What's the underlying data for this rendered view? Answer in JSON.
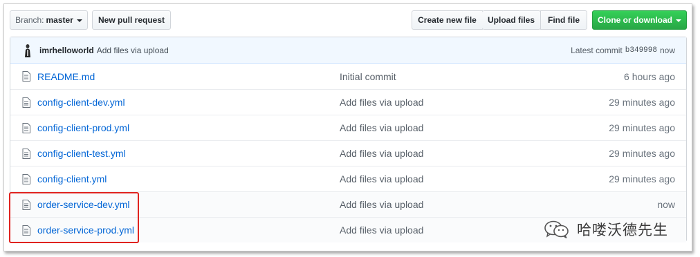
{
  "toolbar": {
    "branch_prefix": "Branch:",
    "branch_name": "master",
    "new_pull_request": "New pull request",
    "create_new_file": "Create new file",
    "upload_files": "Upload files",
    "find_file": "Find file",
    "clone_or_download": "Clone or download"
  },
  "commit_tease": {
    "author": "imrhelloworld",
    "message": "Add files via upload",
    "latest_label": "Latest commit",
    "sha": "b349998",
    "age": "now"
  },
  "files": [
    {
      "name": "README.md",
      "message": "Initial commit",
      "age": "6 hours ago"
    },
    {
      "name": "config-client-dev.yml",
      "message": "Add files via upload",
      "age": "29 minutes ago"
    },
    {
      "name": "config-client-prod.yml",
      "message": "Add files via upload",
      "age": "29 minutes ago"
    },
    {
      "name": "config-client-test.yml",
      "message": "Add files via upload",
      "age": "29 minutes ago"
    },
    {
      "name": "config-client.yml",
      "message": "Add files via upload",
      "age": "29 minutes ago"
    },
    {
      "name": "order-service-dev.yml",
      "message": "Add files via upload",
      "age": "now"
    },
    {
      "name": "order-service-prod.yml",
      "message": "Add files via upload",
      "age": ""
    }
  ],
  "watermark": {
    "text": "哈喽沃德先生"
  },
  "colors": {
    "link": "#0366d6",
    "clone_green": "#28a745",
    "highlight_red": "#e0231f",
    "commit_bg": "#f1f8ff"
  },
  "icons": {
    "file": "file-text-icon",
    "caret": "caret-down-icon",
    "avatar": "user-avatar",
    "watermark": "wechat-icon"
  }
}
